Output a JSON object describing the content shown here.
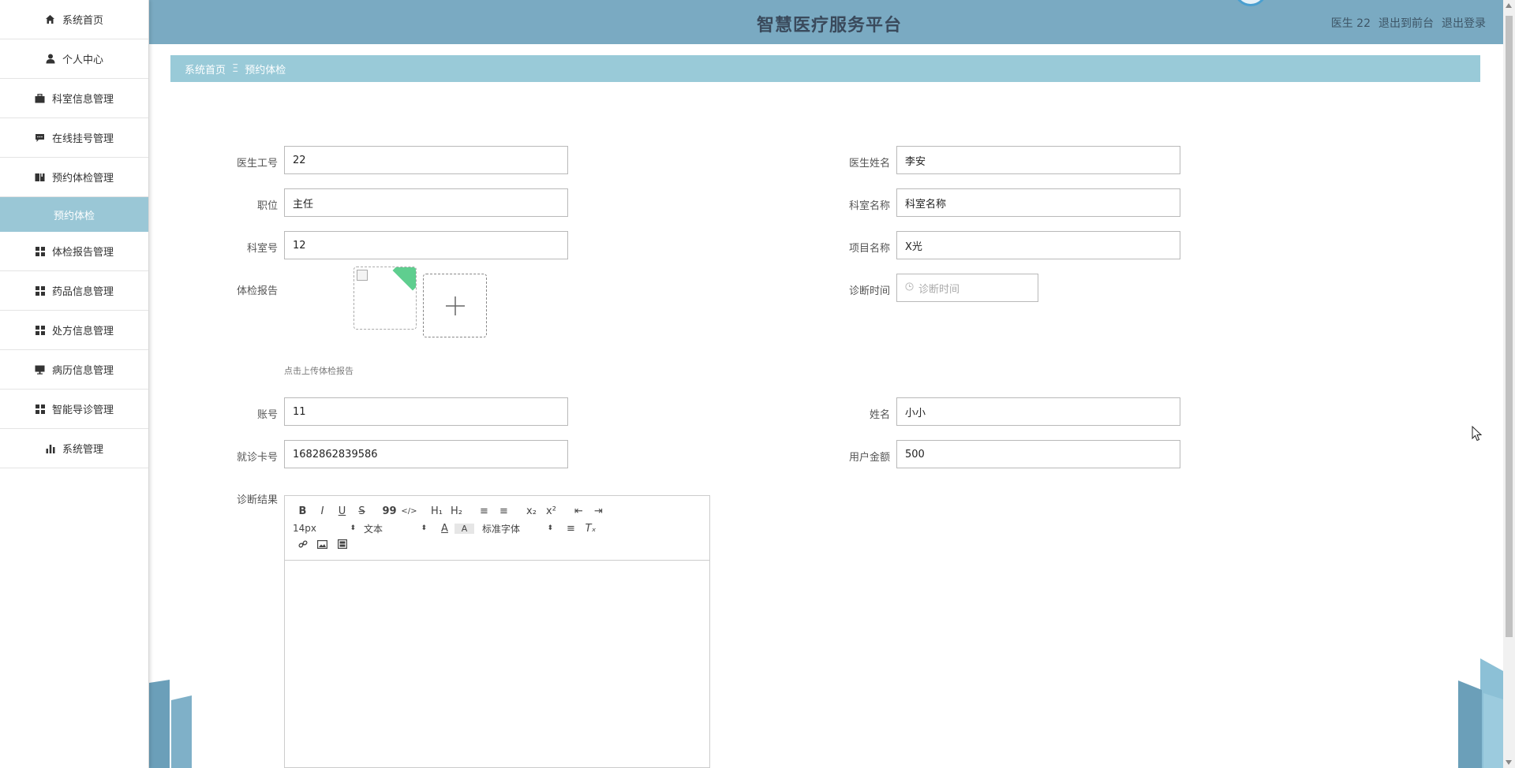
{
  "header": {
    "title": "智慧医疗服务平台",
    "user": "医生 22",
    "to_front": "退出到前台",
    "logout": "退出登录"
  },
  "sidebar": {
    "items": [
      {
        "label": "系统首页",
        "icon": "home-icon"
      },
      {
        "label": "个人中心",
        "icon": "user-icon"
      },
      {
        "label": "科室信息管理",
        "icon": "briefcase-icon"
      },
      {
        "label": "在线挂号管理",
        "icon": "comment-icon"
      },
      {
        "label": "预约体检管理",
        "icon": "book-icon"
      },
      {
        "label": "体检报告管理",
        "icon": "grid-icon"
      },
      {
        "label": "药品信息管理",
        "icon": "grid-icon"
      },
      {
        "label": "处方信息管理",
        "icon": "grid-icon"
      },
      {
        "label": "病历信息管理",
        "icon": "monitor-icon"
      },
      {
        "label": "智能导诊管理",
        "icon": "grid-icon"
      },
      {
        "label": "系统管理",
        "icon": "bar-chart-icon"
      }
    ],
    "active_sub": "预约体检"
  },
  "breadcrumb": {
    "home": "系统首页",
    "separator": "Ξ",
    "current": "预约体检"
  },
  "form": {
    "doctor_id": {
      "label": "医生工号",
      "value": "22"
    },
    "doctor_name": {
      "label": "医生姓名",
      "value": "李安"
    },
    "position": {
      "label": "职位",
      "value": "主任"
    },
    "dept_name": {
      "label": "科室名称",
      "value": "科室名称"
    },
    "dept_no": {
      "label": "科室号",
      "value": "12"
    },
    "project_name": {
      "label": "项目名称",
      "value": "X光"
    },
    "report": {
      "label": "体检报告",
      "tip": "点击上传体检报告"
    },
    "diag_time": {
      "label": "诊断时间",
      "placeholder": "诊断时间"
    },
    "account": {
      "label": "账号",
      "value": "11"
    },
    "name": {
      "label": "姓名",
      "value": "小小"
    },
    "card_no": {
      "label": "就诊卡号",
      "value": "1682862839586"
    },
    "balance": {
      "label": "用户金额",
      "value": "500"
    },
    "result": {
      "label": "诊断结果"
    }
  },
  "editor": {
    "font_size": "14px",
    "paragraph": "文本",
    "font_family": "标准字体",
    "buttons": {
      "bold": "B",
      "italic": "I",
      "underline": "U",
      "strike": "S",
      "quote": "99",
      "code": "</>",
      "h1": "H₁",
      "h2": "H₂",
      "ol": "≡",
      "ul": "≡",
      "sub": "x₂",
      "sup": "x²",
      "outdent": "⇤",
      "indent": "⇥",
      "color": "A",
      "bg": "A",
      "align": "≡",
      "clean": "Tₓ"
    }
  },
  "colors": {
    "header_bg": "#7aaac2",
    "breadcrumb_bg": "#99cad8",
    "active_sub_bg": "#9ac7d6"
  }
}
